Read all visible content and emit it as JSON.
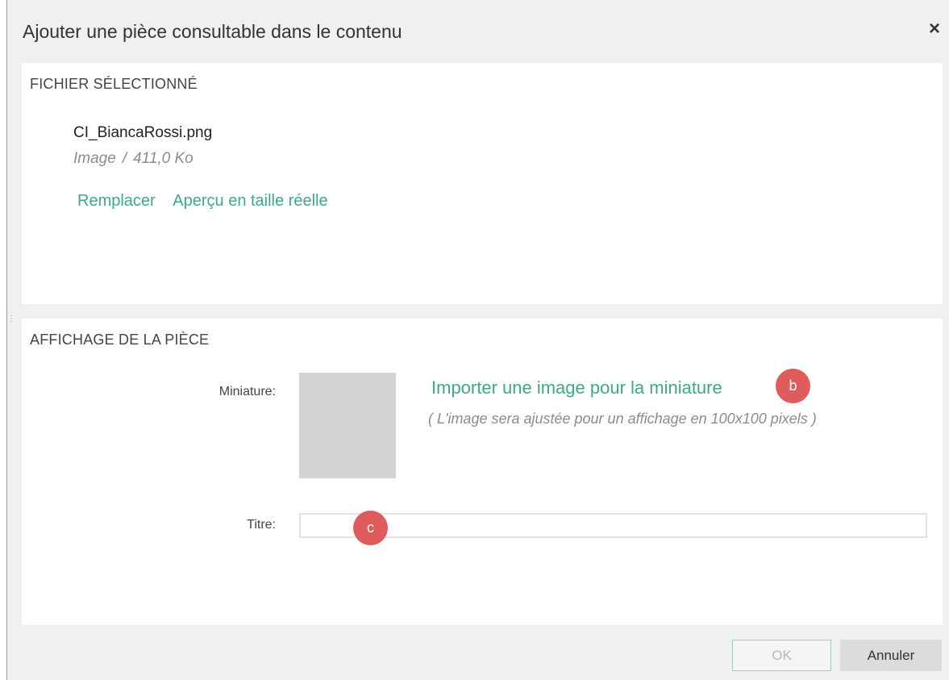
{
  "dialog": {
    "title": "Ajouter une pièce consultable dans le contenu",
    "close_label": "×"
  },
  "file_section": {
    "heading": "FICHIER SÉLECTIONNÉ",
    "file_name": "CI_BiancaRossi.png",
    "file_type": "Image",
    "separator": "/",
    "file_size": "411,0 Ko",
    "replace_label": "Remplacer",
    "preview_label": "Aperçu en taille réelle"
  },
  "display_section": {
    "heading": "AFFICHAGE DE LA PIÈCE",
    "thumbnail_label": "Miniature:",
    "import_label": "Importer une image pour la miniature",
    "import_hint": "( L'image sera ajustée pour un affichage en 100x100 pixels )",
    "title_label": "Titre:",
    "title_value": "",
    "title_placeholder": ""
  },
  "markers": {
    "b": "b",
    "c": "c"
  },
  "footer": {
    "ok_label": "OK",
    "cancel_label": "Annuler"
  },
  "colors": {
    "accent": "#3aaa8c",
    "marker": "#e05b5b",
    "background": "#f0f0f0",
    "thumbnail_placeholder": "#d3d3d3"
  }
}
